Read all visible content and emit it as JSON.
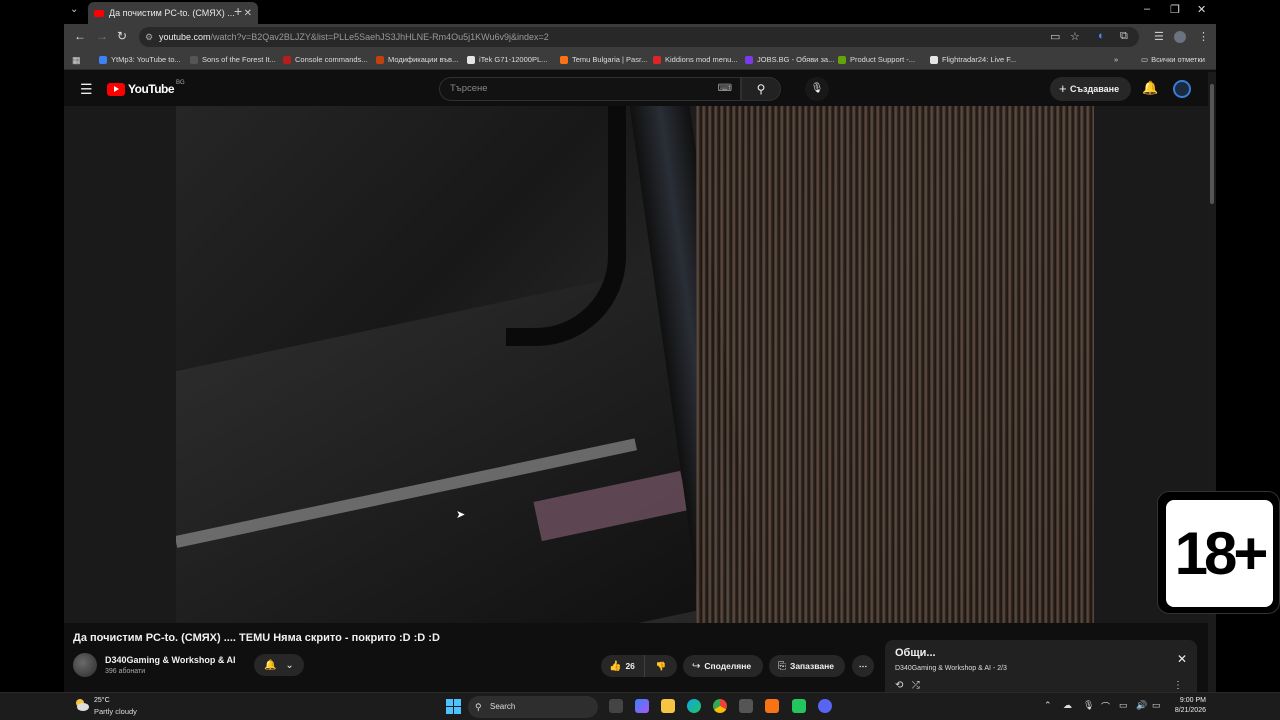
{
  "tab": {
    "title": "Да почистим PC-to. (СМЯХ) ...",
    "new_tab": "+"
  },
  "window_controls": {
    "minimize": "–",
    "restore": "❐",
    "close": "✕"
  },
  "toolbar": {
    "url_host": "youtube.com",
    "url_path": "/watch?v=B2Qav2BLJZY&list=PLLe5SaehJS3JhHLNE-Rm4Ou5j1KWu6v9j&index=2"
  },
  "bookmarks": [
    {
      "label": "YtMp3: YouTube to...",
      "color": "#3b82f6"
    },
    {
      "label": "Sons of the Forest It...",
      "color": "#555555"
    },
    {
      "label": "Console commands...",
      "color": "#b91c1c"
    },
    {
      "label": "Модификации във...",
      "color": "#c2410c"
    },
    {
      "label": "iTek G71-12000PL...",
      "color": "#e5e5e5"
    },
    {
      "label": "Temu Bulgaria | Pasr...",
      "color": "#f97316"
    },
    {
      "label": "Kiddions mod menu...",
      "color": "#dc2626"
    },
    {
      "label": "JOBS.BG - Обяви за...",
      "color": "#7c3aed"
    },
    {
      "label": "Product Support -...",
      "color": "#65a30d"
    },
    {
      "label": "Flightradar24: Live F...",
      "color": "#e5e5e5"
    }
  ],
  "bookmarks_all": "Всички отметки",
  "youtube": {
    "logo": "YouTube",
    "country_code": "BG",
    "search_placeholder": "Търсене",
    "create_label": "Създаване"
  },
  "video": {
    "title": "Да почистим PC-to. (СМЯХ) .... TEMU Няма скрито - покрито :D :D :D",
    "channel": "D340Gaming & Workshop & AI",
    "subscribers": "396 абонати",
    "likes": "26",
    "share_label": "Споделяне",
    "save_label": "Запазване"
  },
  "playlist": {
    "title": "Общи...",
    "subtitle": "D340Gaming & Workshop & AI - 2/3"
  },
  "badge": {
    "text": "18+"
  },
  "taskbar": {
    "temperature": "25°C",
    "weather": "Partly cloudy",
    "search_label": "Search",
    "time": "9:00 PM",
    "date": "8/21/2026"
  },
  "colors": {
    "yt_red": "#ff0000",
    "win_accent": "#4cc2ff",
    "chrome_toolbar": "#3c3c3c"
  }
}
